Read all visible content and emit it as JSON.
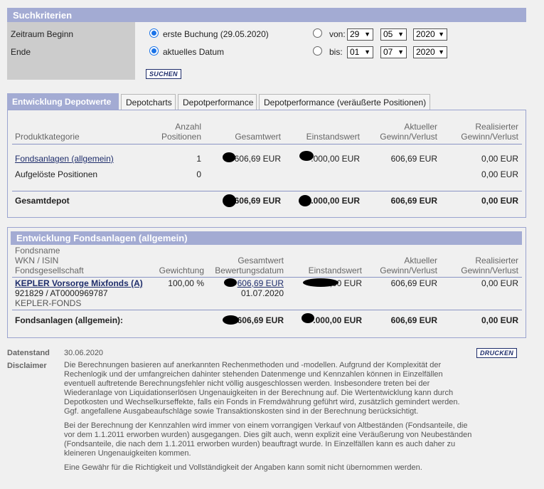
{
  "search": {
    "header": "Suchkriterien",
    "label_start": "Zeitraum Beginn",
    "label_end": "Ende",
    "opt_first_booking": "erste Buchung (29.05.2020)",
    "opt_current_date": "aktuelles Datum",
    "from_label": "von:",
    "to_label": "bis:",
    "from_day": "29",
    "from_month": "05",
    "from_year": "2020",
    "to_day": "01",
    "to_month": "07",
    "to_year": "2020",
    "search_button": "SUCHEN"
  },
  "tabs": [
    {
      "label": "Entwicklung Depotwerte",
      "active": true
    },
    {
      "label": "Depotcharts",
      "active": false
    },
    {
      "label": "Depotperformance",
      "active": false
    },
    {
      "label": "Depotperformance (veräußerte Positionen)",
      "active": false
    }
  ],
  "depot": {
    "columns": {
      "category": "Produktkategorie",
      "count_1": "Anzahl",
      "count_2": "Positionen",
      "total": "Gesamtwert",
      "cost": "Einstandswert",
      "current_1": "Aktueller",
      "current_2": "Gewinn/Verlust",
      "realized_1": "Realisierter",
      "realized_2": "Gewinn/Verlust"
    },
    "rows": [
      {
        "category": "Fondsanlagen (allgemein)",
        "count": "1",
        "total": "606,69 EUR",
        "cost": ".000,00 EUR",
        "current": "606,69 EUR",
        "realized": "0,00 EUR"
      },
      {
        "category": "Aufgelöste Positionen",
        "count": "0",
        "total": "",
        "cost": "",
        "current": "",
        "realized": "0,00 EUR"
      }
    ],
    "total_row": {
      "category": "Gesamtdepot",
      "total": "606,69 EUR",
      "cost": ".000,00 EUR",
      "current": "606,69 EUR",
      "realized": "0,00 EUR"
    }
  },
  "funds": {
    "header": "Entwicklung Fondsanlagen (allgemein)",
    "columns": {
      "name_1": "Fondsname",
      "name_2": "WKN / ISIN",
      "name_3": "Fondsgesellschaft",
      "weight": "Gewichtung",
      "total_1": "Gesamtwert",
      "total_2": "Bewertungsdatum",
      "cost": "Einstandswert",
      "current_1": "Aktueller",
      "current_2": "Gewinn/Verlust",
      "realized_1": "Realisierter",
      "realized_2": "Gewinn/Verlust"
    },
    "row": {
      "name": "KEPLER Vorsorge Mixfonds (A)",
      "wkn_isin": "921829 /  AT0000969787",
      "company": "KEPLER-FONDS",
      "weight": "100,00 %",
      "total": "606,69 EUR",
      "date": "01.07.2020",
      "cost": "000,00 EUR",
      "current": "606,69 EUR",
      "realized": "0,00 EUR"
    },
    "total_row": {
      "label": "Fondsanlagen (allgemein):",
      "total": "606,69 EUR",
      "cost": ".000,00 EUR",
      "current": "606,69 EUR",
      "realized": "0,00 EUR"
    }
  },
  "footer": {
    "date_label": "Datenstand",
    "date_value": "30.06.2020",
    "print_button": "DRUCKEN",
    "disclaimer_label": "Disclaimer",
    "p1": "Die Berechnungen basieren auf anerkannten Rechenmethoden und -modellen. Aufgrund der Komplexität der Rechenlogik und der umfangreichen dahinter stehenden Datenmenge und Kennzahlen können in Einzelfällen eventuell auftretende Berechnungsfehler nicht völlig ausgeschlossen werden. Insbesondere treten bei der Wiederanlage von Liquidationserlösen Ungenauigkeiten in der Berechnung auf. Die Wertentwicklung kann durch Depotkosten und Wechselkurseffekte, falls ein Fonds in Fremdwährung geführt wird, zusätzlich gemindert werden. Ggf. angefallene Ausgabeaufschläge sowie Transaktionskosten sind in der Berechnung berücksichtigt.",
    "p2": "Bei der Berechnung der Kennzahlen wird immer von einem vorrangigen Verkauf von Altbeständen (Fondsanteile, die vor dem 1.1.2011 erworben wurden) ausgegangen. Dies gilt auch, wenn explizit eine Veräußerung von Neubeständen (Fondsanteile, die nach dem 1.1.2011 erworben wurden) beauftragt wurde. In Einzelfällen kann es auch daher zu kleineren Ungenauigkeiten kommen.",
    "p3": "Eine Gewähr für die Richtigkeit und Vollständigkeit der Angaben kann somit nicht übernommen werden."
  }
}
